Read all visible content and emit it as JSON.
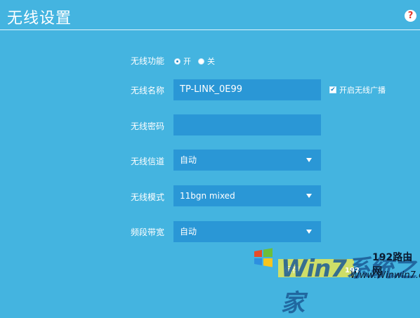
{
  "header": {
    "title": "无线设置",
    "help_glyph": "?"
  },
  "wireless": {
    "function_label": "无线功能",
    "on_label": "开",
    "off_label": "关",
    "selected": "开",
    "name_label": "无线名称",
    "name_value": "TP-LINK_0E99",
    "broadcast_label": "开启无线广播",
    "broadcast_checked": true,
    "password_label": "无线密码",
    "password_value": "",
    "channel_label": "无线信道",
    "channel_value": "自动",
    "mode_label": "无线模式",
    "mode_value": "11bgn mixed",
    "bandwidth_label": "频段带宽",
    "bandwidth_value": "自动"
  },
  "footer": {
    "save_label": "保存"
  },
  "watermark": {
    "win_text": "Win7系统之家",
    "brand": "192路由网",
    "site": "Www.Winwin7.com",
    "num": "192"
  },
  "colors": {
    "background": "#44b4e0",
    "field": "#2a97d6",
    "help": "#e23a2e"
  },
  "icons": [
    "help-icon",
    "dropdown-caret-icon",
    "checkbox-check-icon",
    "windows-logo-icon"
  ]
}
